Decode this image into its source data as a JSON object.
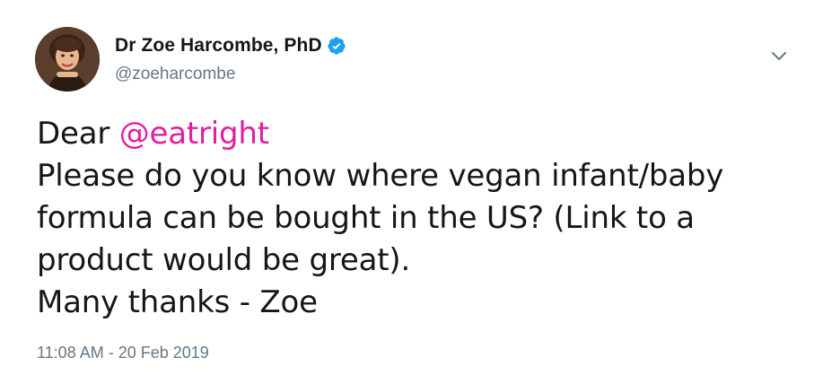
{
  "author": {
    "display_name": "Dr Zoe Harcombe, PhD",
    "handle": "@zoeharcombe",
    "verified": true,
    "avatar_icon": "profile-photo"
  },
  "tweet": {
    "greeting": "Dear ",
    "mention": "@eatright",
    "line2": "Please do you know where vegan infant/baby",
    "line3": "formula can be bought in the US? (Link to a",
    "line4": "product would be great).",
    "line5": "Many thanks - Zoe"
  },
  "timestamp": "11:08 AM - 20 Feb 2019",
  "colors": {
    "mention": "#e0209f",
    "verified_badge": "#1da1f2",
    "secondary_text": "#657786"
  },
  "icons": {
    "verified": "verified-badge-icon",
    "menu": "chevron-down-icon"
  }
}
